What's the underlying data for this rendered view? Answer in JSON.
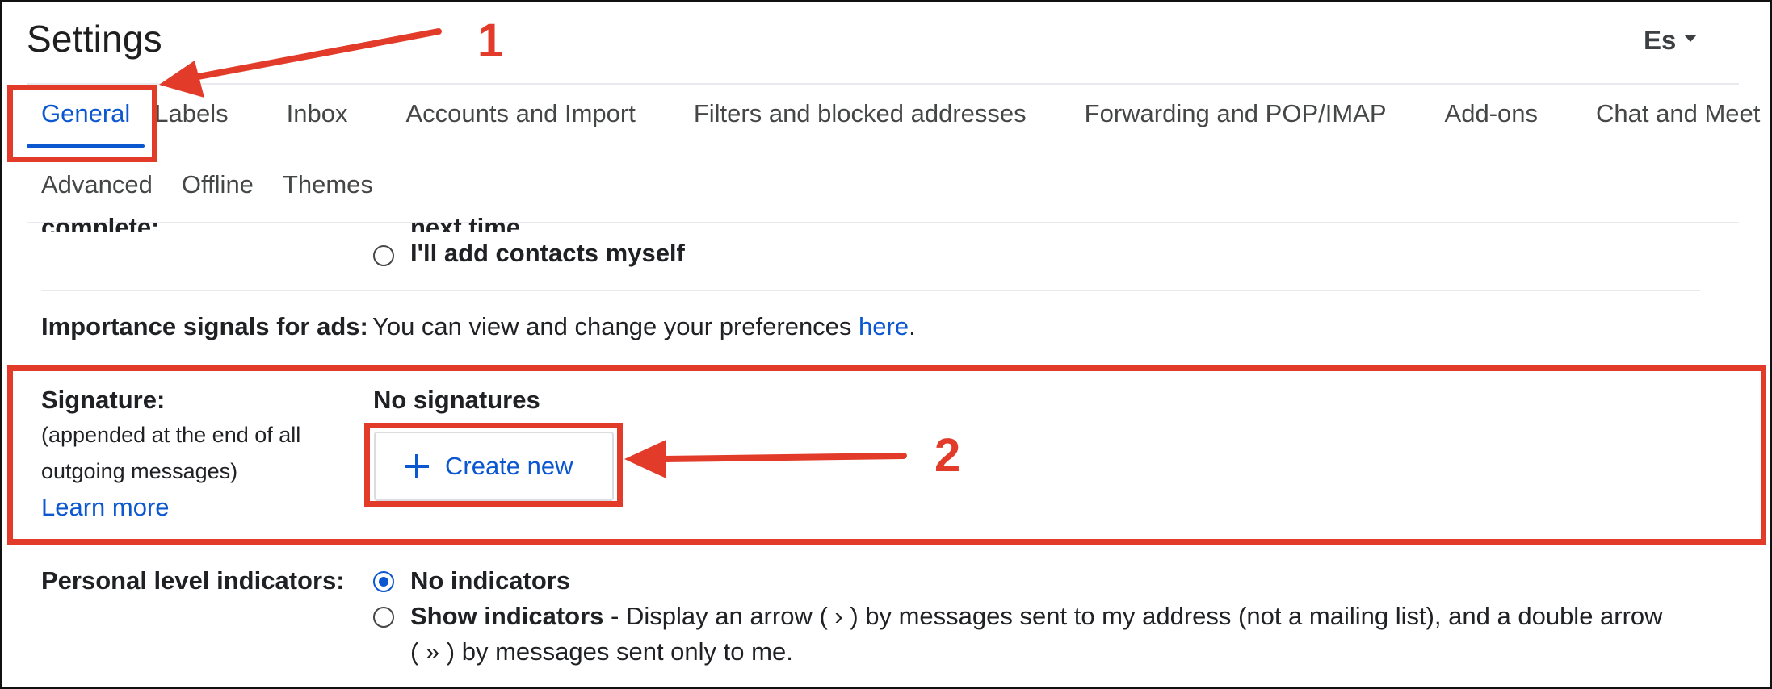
{
  "header": {
    "title": "Settings",
    "language_selector": "Es"
  },
  "tabs_row1": [
    {
      "label": "General",
      "active": true
    },
    {
      "label": "Labels"
    },
    {
      "label": "Inbox"
    },
    {
      "label": "Accounts and Import"
    },
    {
      "label": "Filters and blocked addresses"
    },
    {
      "label": "Forwarding and POP/IMAP"
    },
    {
      "label": "Add-ons"
    },
    {
      "label": "Chat and Meet"
    }
  ],
  "tabs_row2": [
    {
      "label": "Advanced"
    },
    {
      "label": "Offline"
    },
    {
      "label": "Themes"
    }
  ],
  "autocomplete": {
    "clipped_label": "complete:",
    "clipped_option": "next time.",
    "option_manual": "I'll add contacts myself"
  },
  "importance": {
    "label": "Importance signals for ads:",
    "text": "You can view and change your preferences",
    "link": "here",
    "suffix": "."
  },
  "signature": {
    "label": "Signature:",
    "note_line1": "(appended at the end of all",
    "note_line2": "outgoing messages)",
    "learn_more": "Learn more",
    "status": "No signatures",
    "create_button": "Create new"
  },
  "personal_indicators": {
    "label": "Personal level indicators:",
    "option1": "No indicators",
    "option2_title": "Show indicators",
    "option2_desc_line1": " - Display an arrow ( › ) by messages sent to my address (not a mailing list), and a double arrow",
    "option2_desc_line2": "( » ) by messages sent only to me.",
    "selected": "No indicators"
  },
  "annotations": {
    "callout1": "1",
    "callout2": "2",
    "color": "#e23b2a"
  },
  "colors": {
    "accent": "#0b57d0",
    "text": "#202124",
    "divider": "#e8eaed"
  }
}
